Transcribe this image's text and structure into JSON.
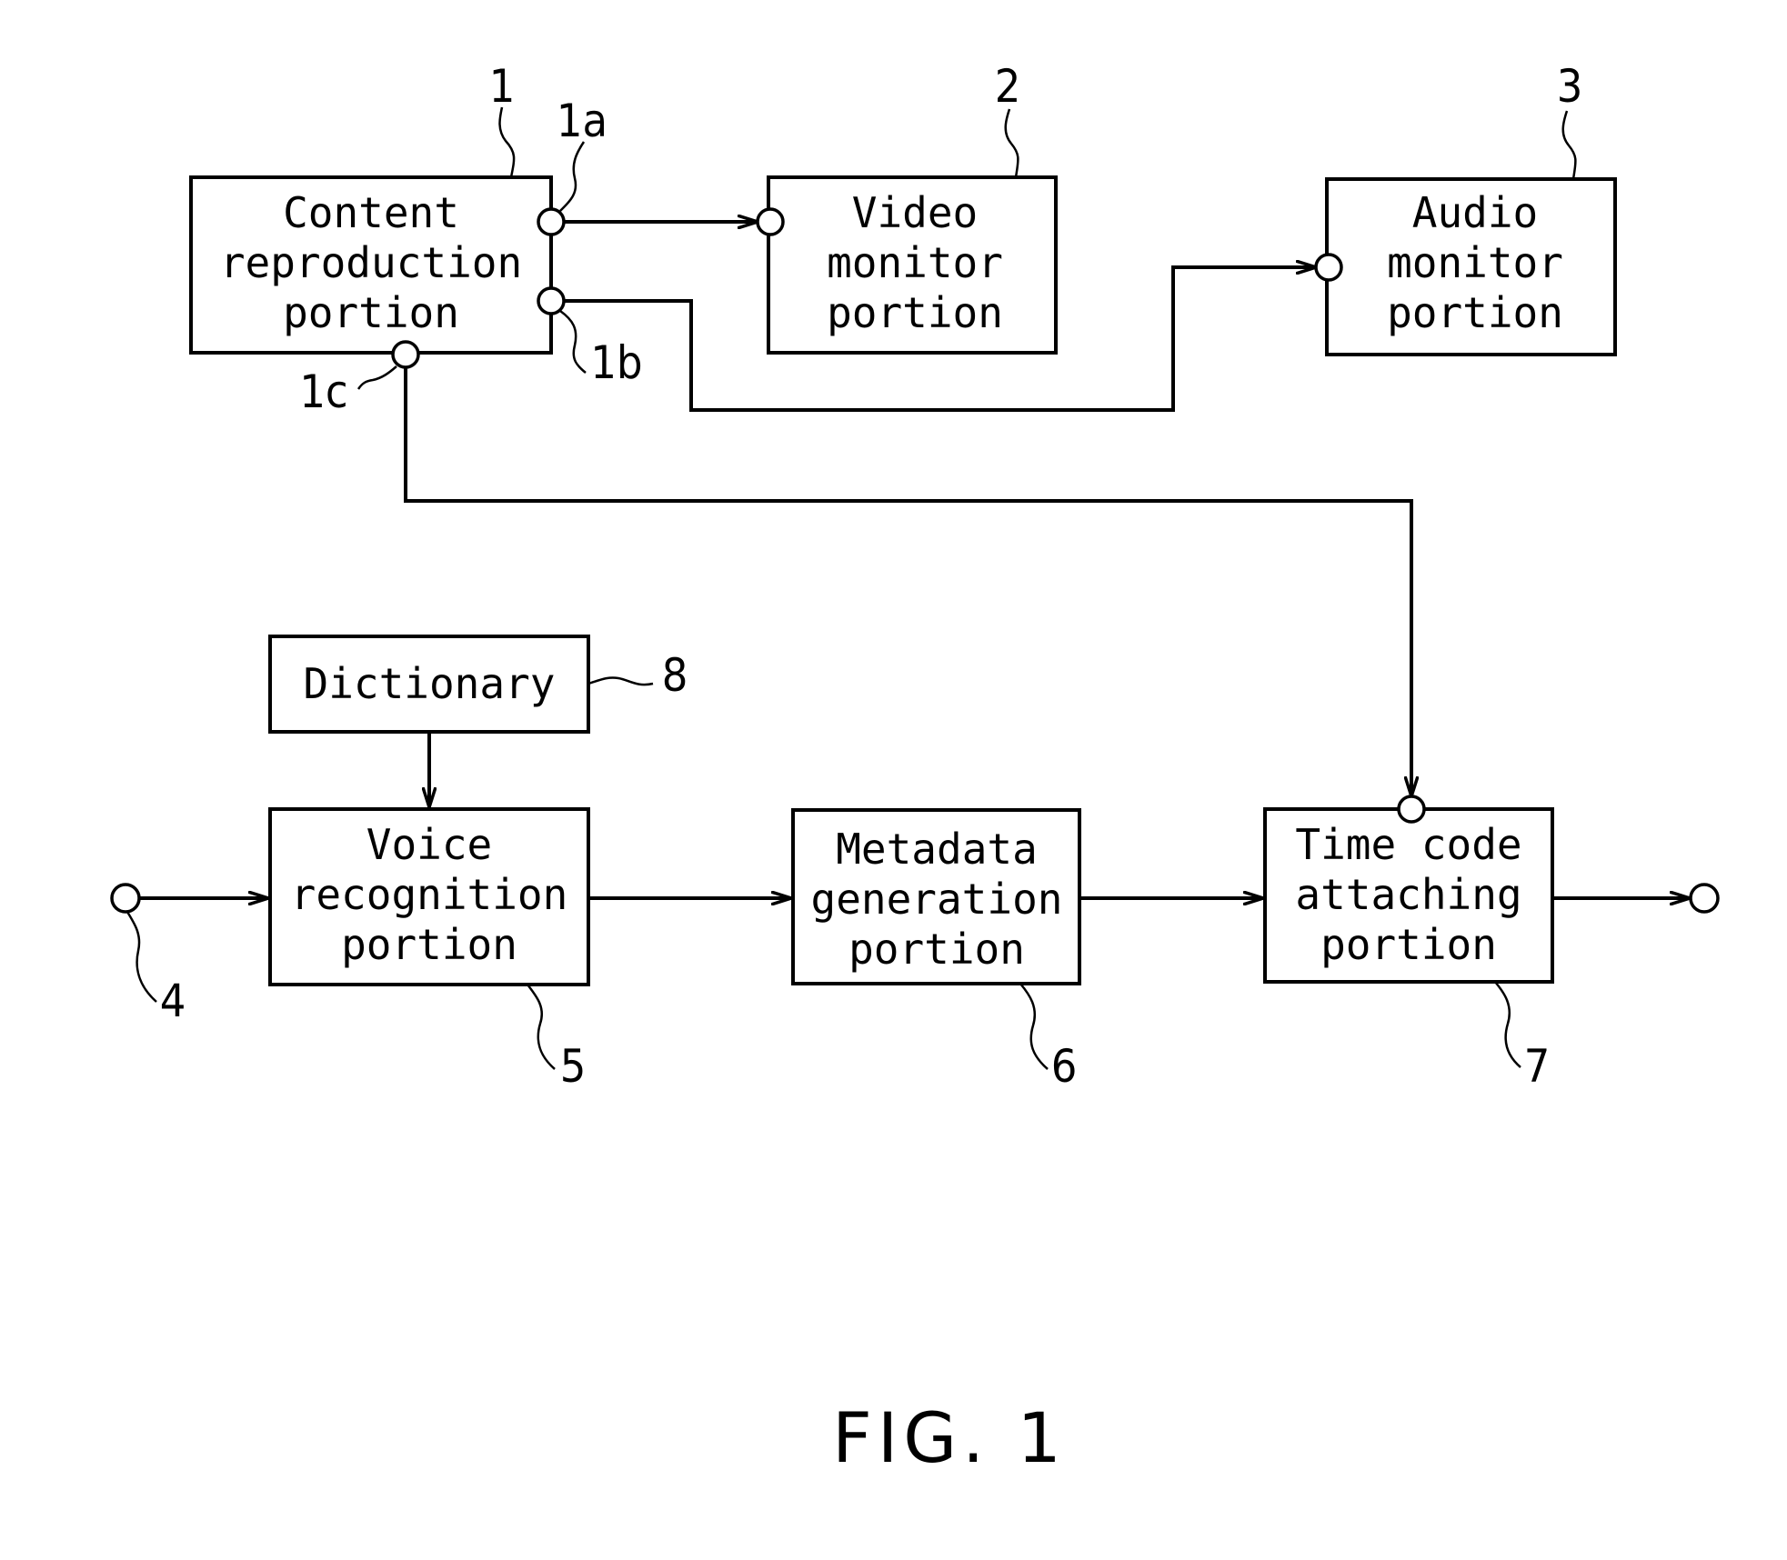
{
  "figure_label": "FIG. 1",
  "blocks": {
    "content_reproduction": {
      "ref": "1",
      "lines": [
        "Content",
        "reproduction",
        "portion"
      ]
    },
    "video_monitor": {
      "ref": "2",
      "lines": [
        "Video",
        "monitor",
        "portion"
      ]
    },
    "audio_monitor": {
      "ref": "3",
      "lines": [
        "Audio",
        "monitor",
        "portion"
      ]
    },
    "voice_recognition": {
      "ref": "5",
      "lines": [
        "Voice",
        "recognition",
        "portion"
      ]
    },
    "metadata_generation": {
      "ref": "6",
      "lines": [
        "Metadata",
        "generation",
        "portion"
      ]
    },
    "time_code_attaching": {
      "ref": "7",
      "lines": [
        "Time code",
        "attaching",
        "portion"
      ]
    },
    "dictionary": {
      "ref": "8",
      "lines": [
        "Dictionary"
      ]
    }
  },
  "ports": {
    "video_out": "1a",
    "audio_out": "1b",
    "time_code_out": "1c",
    "voice_input": "4"
  },
  "connections": [
    {
      "from": "content_reproduction.1a",
      "to": "video_monitor"
    },
    {
      "from": "content_reproduction.1b",
      "to": "audio_monitor"
    },
    {
      "from": "content_reproduction.1c",
      "to": "time_code_attaching"
    },
    {
      "from": "dictionary",
      "to": "voice_recognition"
    },
    {
      "from": "input.4",
      "to": "voice_recognition"
    },
    {
      "from": "voice_recognition",
      "to": "metadata_generation"
    },
    {
      "from": "metadata_generation",
      "to": "time_code_attaching"
    },
    {
      "from": "time_code_attaching",
      "to": "output"
    }
  ]
}
